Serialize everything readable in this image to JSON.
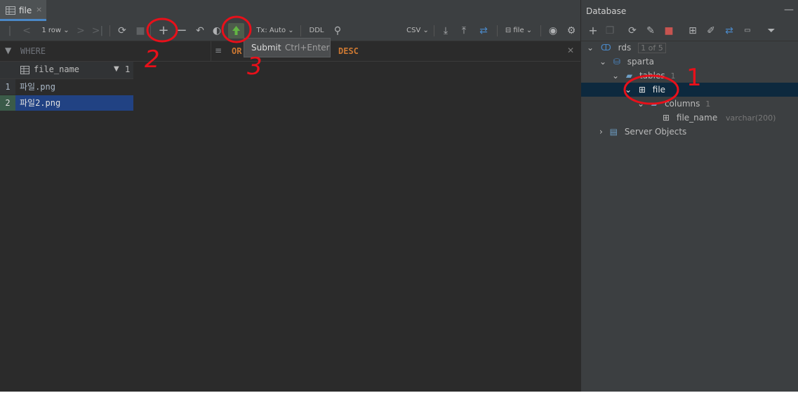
{
  "editor": {
    "tab_label": "file",
    "tab_close": "×",
    "toolbar": {
      "rows_label": "1 row",
      "tx_mode": "Tx: Auto",
      "ddl": "DDL",
      "export_format": "CSV",
      "table_selector": "file"
    },
    "filter": {
      "where": "WHERE",
      "order_prefix": "OR",
      "desc": "DESC"
    },
    "tooltip": {
      "action": "Submit",
      "shortcut": "Ctrl+Enter"
    },
    "grid": {
      "column": "file_name",
      "sort_order": "1",
      "rows": [
        {
          "num": "1",
          "value": "파일.png"
        },
        {
          "num": "2",
          "value": "파일2.png"
        }
      ]
    }
  },
  "db": {
    "title": "Database",
    "tree": {
      "rds": "rds",
      "rds_count": "1 of 5",
      "sparta": "sparta",
      "tables": "tables",
      "tables_count": "1",
      "file": "file",
      "columns": "columns",
      "columns_count": "1",
      "col_name": "file_name",
      "col_type": "varchar(200)",
      "server_objects": "Server Objects"
    }
  },
  "annotations": {
    "one": "1",
    "two": "2",
    "three": "3"
  },
  "colors": {
    "accent": "#4a88c7",
    "selection": "#214283",
    "annotation": "#e8101a",
    "submit_green": "#62b543"
  }
}
